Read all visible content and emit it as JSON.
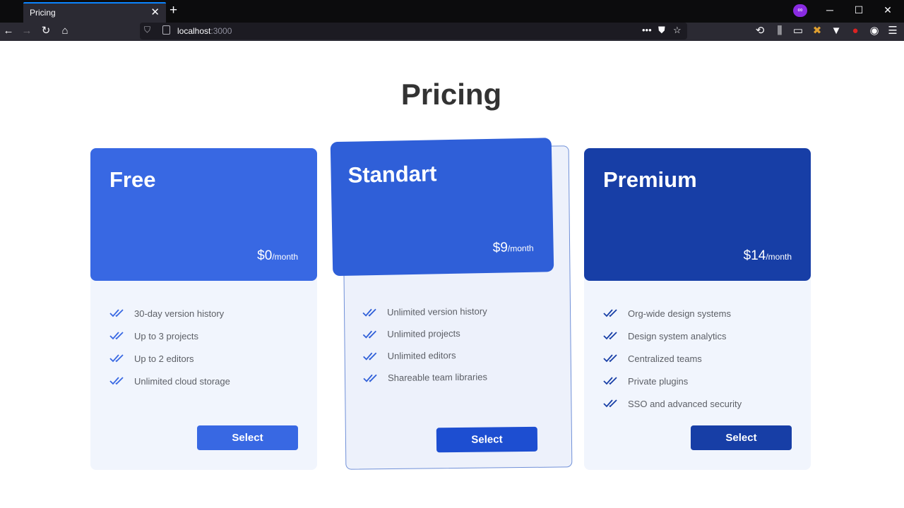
{
  "browser": {
    "tab_title": "Pricing",
    "url_host": "localhost",
    "url_port": ":3000"
  },
  "page": {
    "title": "Pricing"
  },
  "plans": [
    {
      "name": "Free",
      "price": "$0",
      "period": "/month",
      "features": [
        "30-day version history",
        "Up to 3 projects",
        "Up to 2 editors",
        "Unlimited cloud storage"
      ],
      "button": "Select",
      "color": "#3868e3"
    },
    {
      "name": "Standart",
      "price": "$9",
      "period": "/month",
      "features": [
        "Unlimited version history",
        "Unlimited projects",
        "Unlimited editors",
        "Shareable team libraries"
      ],
      "button": "Select",
      "color": "#2f5fd8"
    },
    {
      "name": "Premium",
      "price": "$14",
      "period": "/month",
      "features": [
        "Org-wide design systems",
        "Design system analytics",
        "Centralized teams",
        "Private plugins",
        "SSO and advanced security"
      ],
      "button": "Select",
      "color": "#173ea6"
    }
  ]
}
